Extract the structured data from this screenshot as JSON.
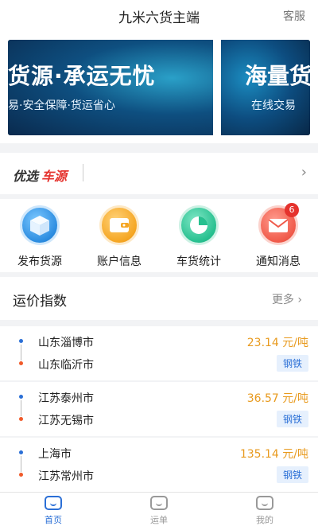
{
  "header": {
    "title": "九米六货主端",
    "service_label": "客服"
  },
  "banner": {
    "slide1_big": "货源·承运无忧",
    "slide1_small": "易·安全保障·货运省心",
    "slide2_big": "海量货",
    "slide2_small": "在线交易"
  },
  "preferred": {
    "part1": "优选",
    "part2": "车源"
  },
  "quick_actions": [
    {
      "label": "发布货源",
      "icon": "box-icon"
    },
    {
      "label": "账户信息",
      "icon": "wallet-icon"
    },
    {
      "label": "车货统计",
      "icon": "pie-chart-icon"
    },
    {
      "label": "通知消息",
      "icon": "mail-icon",
      "badge": "6"
    }
  ],
  "rates": {
    "title": "运价指数",
    "more_label": "更多",
    "items": [
      {
        "from": "山东淄博市",
        "to": "山东临沂市",
        "price": "23.14 元/吨",
        "tag": "钢铁"
      },
      {
        "from": "江苏泰州市",
        "to": "江苏无锡市",
        "price": "36.57 元/吨",
        "tag": "钢铁"
      },
      {
        "from": "上海市",
        "to": "江苏常州市",
        "price": "135.14 元/吨",
        "tag": "钢铁"
      }
    ]
  },
  "tabbar": [
    {
      "label": "首页",
      "active": true
    },
    {
      "label": "运单",
      "active": false
    },
    {
      "label": "我的",
      "active": false
    }
  ],
  "colors": {
    "accent": "#2b6fd6",
    "price": "#e89a1e",
    "red": "#e5322d"
  }
}
